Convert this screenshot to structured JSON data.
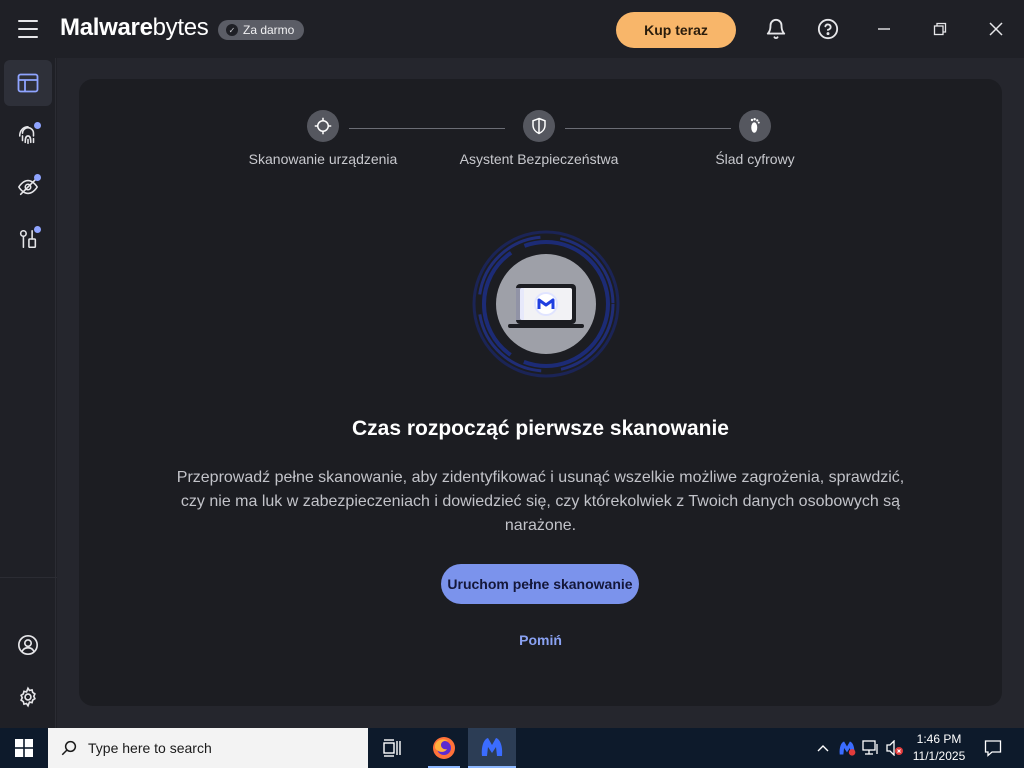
{
  "app": {
    "logo_bold": "Malware",
    "logo_light": "bytes",
    "plan_badge": "Za darmo",
    "buy_button": "Kup teraz"
  },
  "stepper": {
    "steps": [
      {
        "label": "Skanowanie urządzenia",
        "icon": "crosshair-icon"
      },
      {
        "label": "Asystent Bezpieczeństwa",
        "icon": "shield-icon"
      },
      {
        "label": "Ślad cyfrowy",
        "icon": "footprint-icon"
      }
    ]
  },
  "main": {
    "headline": "Czas rozpocząć pierwsze skanowanie",
    "description": "Przeprowadź pełne skanowanie, aby zidentyfikować i usunąć wszelkie możliwe zagrożenia, sprawdzić, czy nie ma luk w zabezpieczeniach i dowiedzieć się, czy którekolwiek z Twoich danych osobowych są narażone.",
    "primary_button": "Uruchom pełne skanowanie",
    "skip_link": "Pomiń"
  },
  "sidebar": {
    "items": [
      "dashboard-icon",
      "fingerprint-icon",
      "privacy-eye-icon",
      "tools-icon"
    ],
    "bottom": [
      "account-icon",
      "settings-gear-icon"
    ]
  },
  "taskbar": {
    "search_placeholder": "Type here to search",
    "time": "1:46 PM",
    "date": "11/1/2025"
  },
  "colors": {
    "accent": "#7b93ec",
    "buy": "#f8b66a",
    "background": "#1f2026",
    "card": "#1c1d22"
  }
}
